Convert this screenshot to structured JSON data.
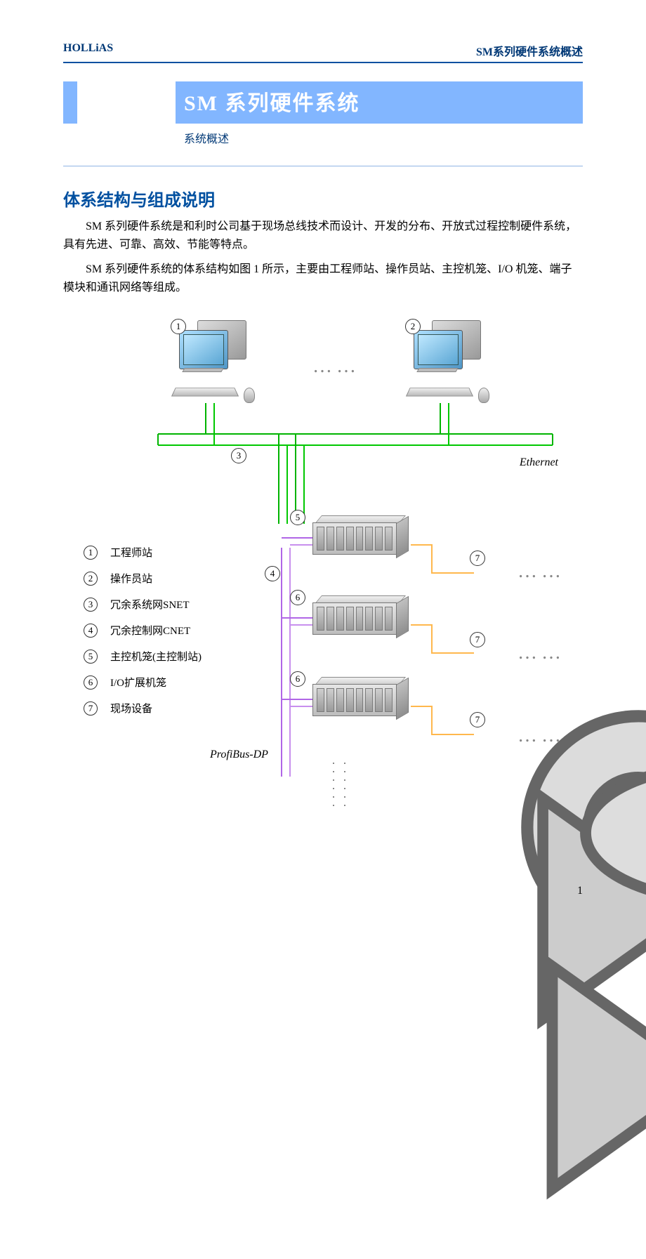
{
  "header": {
    "left": "HOLLiAS",
    "right": "SM系列硬件系统概述"
  },
  "title": {
    "main": "SM 系列硬件系统",
    "sub": "系统概述"
  },
  "section_heading": "体系结构与组成说明",
  "paragraphs": [
    "SM 系列硬件系统是和利时公司基于现场总线技术而设计、开发的分布、开放式过程控制硬件系统，具有先进、可靠、高效、节能等特点。",
    "SM 系列硬件系统的体系结构如图 1 所示，主要由工程师站、操作员站、主控机笼、I/O 机笼、端子模块和通讯网络等组成。"
  ],
  "diagram": {
    "ellipsis": "……",
    "ethernet": "Ethernet",
    "profibus": "ProfiBus-DP",
    "ws_badges": [
      "1",
      "2"
    ],
    "net_badges": [
      "3",
      "4"
    ],
    "rack_badges": [
      "5",
      "6",
      "6"
    ],
    "device_badges": [
      "7",
      "7",
      "7"
    ]
  },
  "legend": [
    {
      "num": "1",
      "label": "工程师站"
    },
    {
      "num": "2",
      "label": "操作员站"
    },
    {
      "num": "3",
      "label": "冗余系统网SNET"
    },
    {
      "num": "4",
      "label": "冗余控制网CNET"
    },
    {
      "num": "5",
      "label": "主控机笼(主控制站)"
    },
    {
      "num": "6",
      "label": "I/O扩展机笼"
    },
    {
      "num": "7",
      "label": "现场设备"
    }
  ],
  "page_number": "1"
}
